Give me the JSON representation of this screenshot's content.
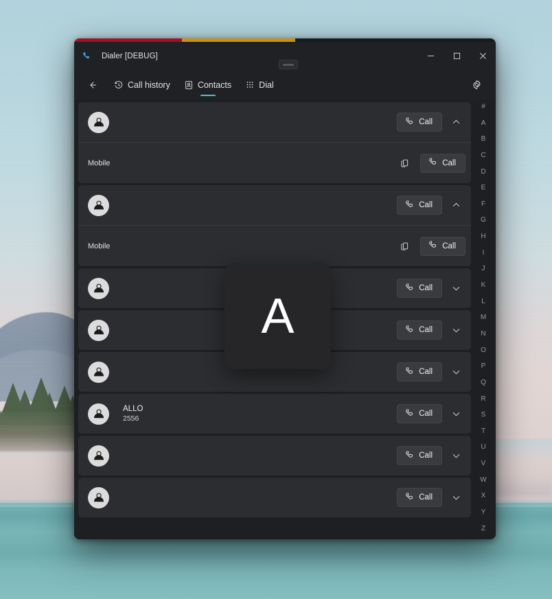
{
  "window": {
    "title": "Dialer [DEBUG]",
    "app_icon": "phone-icon",
    "accent": {
      "red": "#a31127",
      "amber": "#c99311",
      "tab_active": "#4cc2d4"
    },
    "controls": {
      "minimize": "‒",
      "maximize": "□",
      "close": "×"
    }
  },
  "navbar": {
    "back_label": "←",
    "tabs": [
      {
        "label": "Call history",
        "icon": "clock-history-icon",
        "active": false
      },
      {
        "label": "Contacts",
        "icon": "contact-card-icon",
        "active": true
      },
      {
        "label": "Dial",
        "icon": "dialpad-icon",
        "active": false
      }
    ],
    "settings_icon": "gear-icon"
  },
  "list": {
    "call_label": "Call",
    "mobile_label": "Mobile",
    "contacts": [
      {
        "name": "",
        "number": "",
        "expanded": true,
        "detail_label": "Mobile"
      },
      {
        "name": "",
        "number": "",
        "expanded": true,
        "detail_label": "Mobile"
      },
      {
        "name": "",
        "number": "",
        "expanded": false
      },
      {
        "name": "",
        "number": "",
        "expanded": false
      },
      {
        "name": "",
        "number": "",
        "expanded": false
      },
      {
        "name": "ALLO",
        "number": "2556",
        "expanded": false
      },
      {
        "name": "",
        "number": "",
        "expanded": false
      },
      {
        "name": "",
        "number": "",
        "expanded": false
      }
    ]
  },
  "alphabet_index": [
    "#",
    "A",
    "B",
    "C",
    "D",
    "E",
    "F",
    "G",
    "H",
    "I",
    "J",
    "K",
    "L",
    "M",
    "N",
    "O",
    "P",
    "Q",
    "R",
    "S",
    "T",
    "U",
    "V",
    "W",
    "X",
    "Y",
    "Z"
  ],
  "letter_overlay": {
    "letter": "A"
  }
}
